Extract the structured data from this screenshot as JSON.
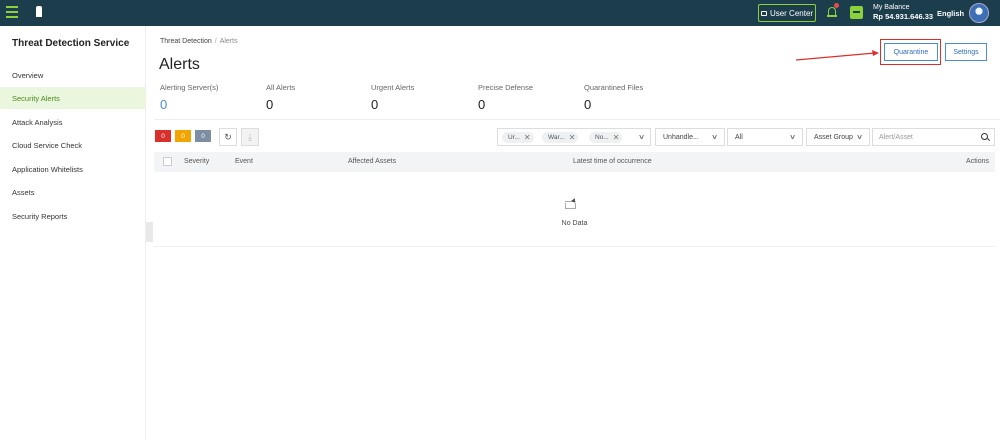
{
  "topbar": {
    "user_center_label": "User Center",
    "balance_label": "My Balance",
    "balance_value": "Rp 54.931.646.33",
    "language": "English",
    "accent_color": "#8bd13b",
    "background_color": "#1c3d4b"
  },
  "sidebar": {
    "title": "Threat Detection Service",
    "items": [
      {
        "label": "Overview"
      },
      {
        "label": "Security Alerts"
      },
      {
        "label": "Attack Analysis"
      },
      {
        "label": "Cloud Service Check"
      },
      {
        "label": "Application Whitelists"
      },
      {
        "label": "Assets"
      },
      {
        "label": "Security Reports"
      }
    ]
  },
  "breadcrumb": {
    "root": "Threat Detection",
    "separator": "/",
    "current": "Alerts"
  },
  "page": {
    "title": "Alerts",
    "quarantine_label": "Quarantine",
    "settings_label": "Settings"
  },
  "stats": [
    {
      "label": "Alerting Server(s)",
      "value": "0"
    },
    {
      "label": "All Alerts",
      "value": "0"
    },
    {
      "label": "Urgent Alerts",
      "value": "0"
    },
    {
      "label": "Precise Defense",
      "value": "0"
    },
    {
      "label": "Quarantined Files",
      "value": "0"
    }
  ],
  "severity_counts": [
    {
      "value": "0",
      "color": "#d9302c"
    },
    {
      "value": "0",
      "color": "#f2a500"
    },
    {
      "value": "0",
      "color": "#7d8ea3"
    }
  ],
  "filters": {
    "tags": [
      "Ur...",
      "War...",
      "No..."
    ],
    "status_select": "Unhandle...",
    "type_select": "All",
    "asset_group_select": "Asset Group",
    "search_placeholder": "Alert/Asset"
  },
  "table": {
    "columns": [
      "Severity",
      "Event",
      "Affected Assets",
      "Latest time of occurrence",
      "Actions"
    ],
    "empty_text": "No Data"
  }
}
